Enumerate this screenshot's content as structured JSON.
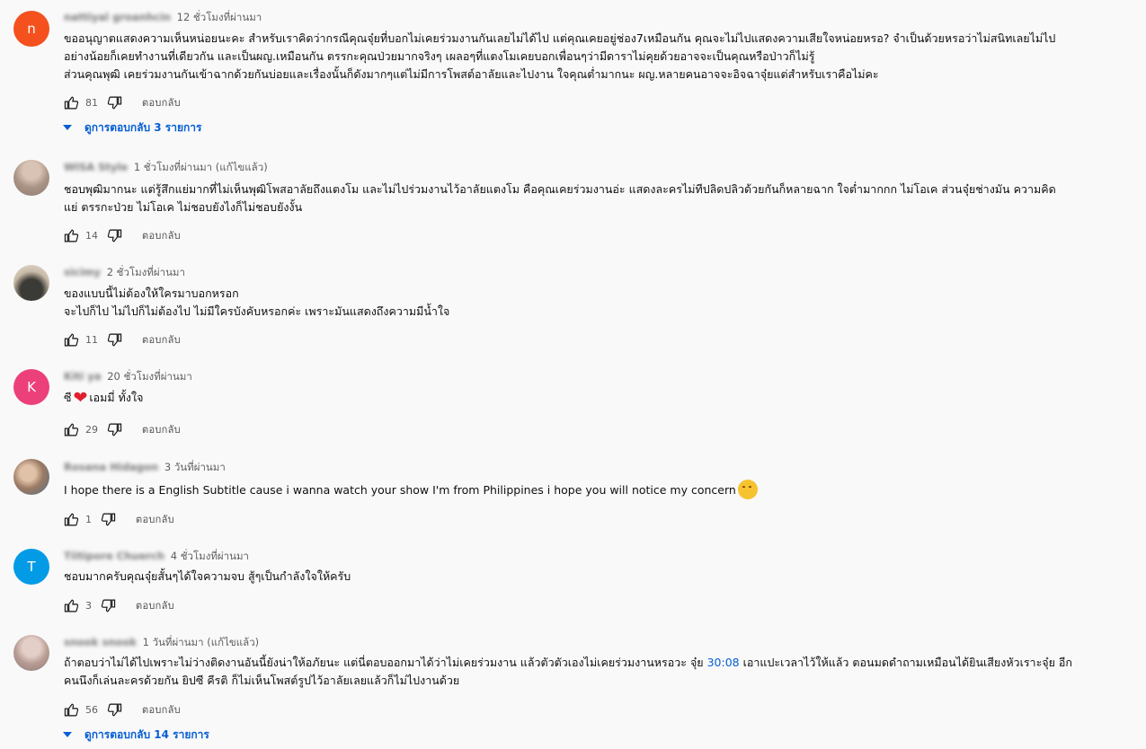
{
  "labels": {
    "reply": "ตอบกลับ"
  },
  "colors": {
    "link": "#065fd4",
    "avatar_orange": "#f4511e",
    "avatar_pink": "#ec407a",
    "avatar_blue": "#039be5"
  },
  "comments": [
    {
      "author": "nattiyal groanhcin",
      "time": "12 ชั่วโมงที่ผ่านมา",
      "avatar_letter": "n",
      "lines": [
        "ขออนุญาตแสดงความเห็นหน่อยนะคะ สำหรับเราคิดว่ากรณีคุณจุ๋ยที่บอกไม่เคยร่วมงานกันเลยไม่ได้ไป แต่คุณเคยอยู่ช่อง7เหมือนกัน คุณจะไม่ไปแสดงความเสียใจหน่อยหรอ? จำเป็นด้วยหรอว่าไม่สนิทเลยไม่ไป",
        "อย่างน้อยก็เคยทำงานที่เดียวกัน และเป็นผญ.เหมือนกัน ตรรกะคุณป่วยมากจริงๆ เผลอๆที่แตงโมเคยบอกเพื่อนๆว่ามีดาราไม่คุยด้วยอาจจะเป็นคุณหรือป่าวก็ไม่รู้",
        "ส่วนคุณพุฒิ เคยร่วมงานกันเข้าฉากด้วยกันบ่อยและเรื่องนั้นก็ดังมากๆแต่ไม่มีการโพสต์อาลัยและไปงาน ใจคุณต่ำมากนะ ผญ.หลายคนอาจจะอิจฉาจุ๋ยแต่สำหรับเราคือไม่คะ"
      ],
      "likes": "81",
      "replies_label": "ดูการตอบกลับ 3 รายการ"
    },
    {
      "author": "WISA Style",
      "time": "1 ชั่วโมงที่ผ่านมา (แก้ไขแล้ว)",
      "lines": [
        "ชอบพุฒิมากนะ แต่รู้สึกแย่มากที่ไม่เห็นพุฒิโพสอาลัยถึงแตงโม และไม่ไปร่วมงานไว้อาลัยแตงโม คือคุณเคยร่วมงานอ่ะ แสดงละครไม่ทีปลิดปลิวด้วยกันก็หลายฉาก ใจต่ำมากกก ไม่โอเค ส่วนจุ๋ยช่างมัน ความคิด",
        "แย่ ตรรกะป่วย ไม่โอเค ไม่ชอบยังไงก็ไม่ชอบยังงั้น"
      ],
      "likes": "14"
    },
    {
      "author": "sicimy",
      "time": "2 ชั่วโมงที่ผ่านมา",
      "lines": [
        "ของแบบนี้ไม่ต้องให้ใครมาบอกหรอก",
        "จะไปก็ไป ไม่ไปก็ไม่ต้องไป ไม่มีใครบังคับหรอกค่ะ เพราะมันแสดงถึงความมีน้ำใจ"
      ],
      "likes": "11"
    },
    {
      "author": "Kiti ya",
      "time": "20 ชั่วโมงที่ผ่านมา",
      "avatar_letter": "K",
      "text_before": "ซี",
      "emoji": "heart",
      "text_after": "เอมมี่ ทั้งใจ",
      "likes": "29"
    },
    {
      "author": "Rosana Hidagon",
      "time": "3 วันที่ผ่านมา",
      "text": "I hope there is a English Subtitle cause i wanna watch your show I'm from Philippines i hope you will notice my concern",
      "emoji": "hugging-face",
      "likes": "1"
    },
    {
      "author": "Tiitipore Chuerch",
      "time": "4 ชั่วโมงที่ผ่านมา",
      "avatar_letter": "T",
      "text": "ชอบมากครับคุณจุ๋ยสั้นๆได้ใจความจบ สู้ๆเป็นกำลังใจให้ครับ",
      "likes": "3"
    },
    {
      "author": "snook snook",
      "time": "1 วันที่ผ่านมา (แก้ไขแล้ว)",
      "line1_before": "ถ้าตอบว่าไม่ได้ไปเพราะไม่ว่างติดงานอันนี้ยังน่าให้อภัยนะ แต่นี่ตอบออกมาได้ว่าไม่เคยร่วมงาน แล้วตัวตัวเองไม่เคยร่วมงานหรอวะ จุ๋ย ",
      "timestamp": "30:08",
      "line1_after": " เอาแปะเวลาไว้ให้แล้ว ตอนมดดำถามเหมือนได้ยินเสียงหัวเราะจุ๋ย อีก",
      "line2": "คนนึงก็เล่นละครด้วยกัน ยิปซี คีรติ ก็ไม่เห็นโพสต์รูปไว้อาลัยเลยแล้วก็ไม่ไปงานด้วย",
      "likes": "56",
      "replies_label": "ดูการตอบกลับ 14 รายการ"
    }
  ]
}
